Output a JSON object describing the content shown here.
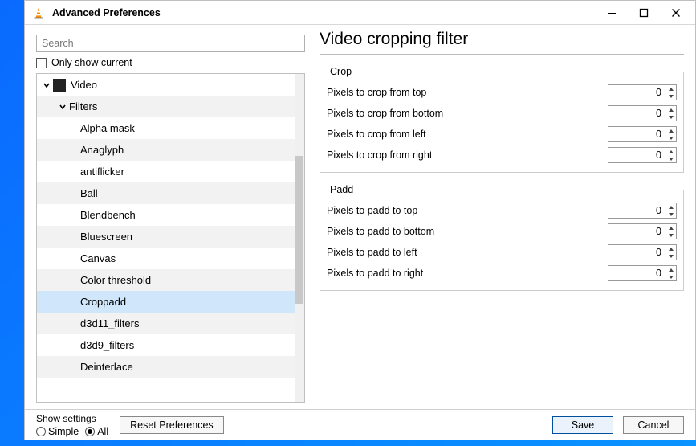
{
  "window": {
    "title": "Advanced Preferences"
  },
  "search": {
    "placeholder": "Search"
  },
  "only_show_current_label": "Only show current",
  "tree": {
    "root": "Video",
    "sub": "Filters",
    "items": [
      "Alpha mask",
      "Anaglyph",
      "antiflicker",
      "Ball",
      "Blendbench",
      "Bluescreen",
      "Canvas",
      "Color threshold",
      "Croppadd",
      "d3d11_filters",
      "d3d9_filters",
      "Deinterlace"
    ],
    "selected": "Croppadd"
  },
  "right": {
    "title": "Video cropping filter",
    "groups": [
      {
        "legend": "Crop",
        "fields": [
          {
            "label": "Pixels to crop from top",
            "value": "0"
          },
          {
            "label": "Pixels to crop from bottom",
            "value": "0"
          },
          {
            "label": "Pixels to crop from left",
            "value": "0"
          },
          {
            "label": "Pixels to crop from right",
            "value": "0"
          }
        ]
      },
      {
        "legend": "Padd",
        "fields": [
          {
            "label": "Pixels to padd to top",
            "value": "0"
          },
          {
            "label": "Pixels to padd to bottom",
            "value": "0"
          },
          {
            "label": "Pixels to padd to left",
            "value": "0"
          },
          {
            "label": "Pixels to padd to right",
            "value": "0"
          }
        ]
      }
    ]
  },
  "bottom": {
    "show_settings_label": "Show settings",
    "simple": "Simple",
    "all": "All",
    "reset": "Reset Preferences",
    "save": "Save",
    "cancel": "Cancel"
  }
}
